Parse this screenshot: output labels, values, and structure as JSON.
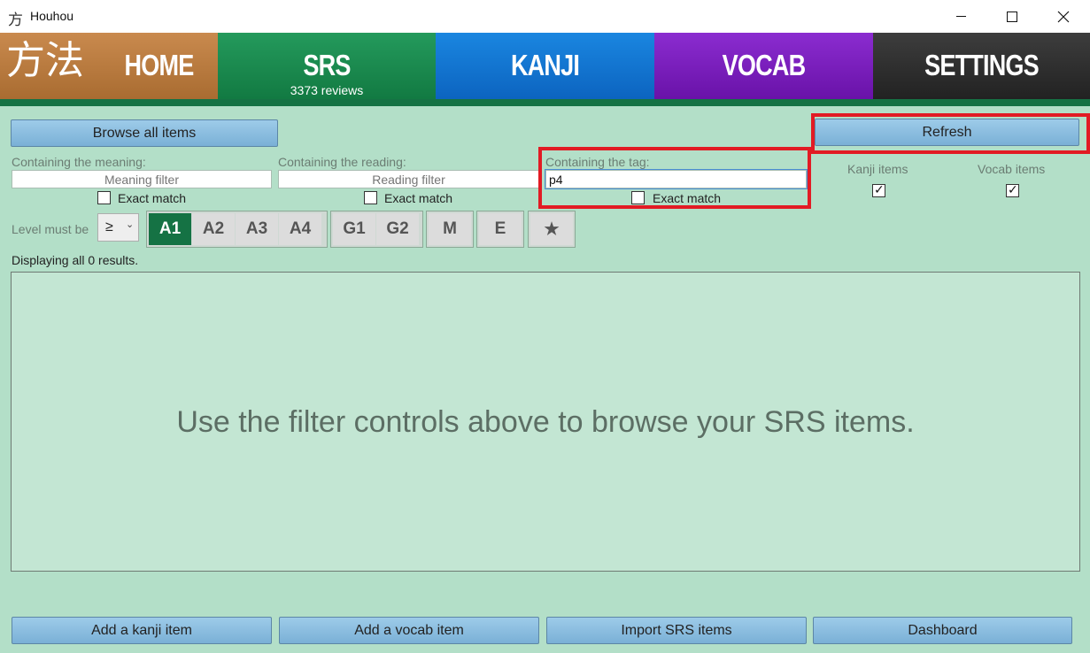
{
  "window": {
    "icon_glyph": "方",
    "title": "Houhou"
  },
  "nav": {
    "logo": "方法",
    "home": "HOME",
    "srs": "SRS",
    "srs_sub": "3373 reviews",
    "kanji": "KANJI",
    "vocab": "VOCAB",
    "settings": "SETTINGS"
  },
  "toolbar": {
    "browse_all": "Browse all items",
    "refresh": "Refresh"
  },
  "filters": {
    "meaning": {
      "label": "Containing the meaning:",
      "placeholder": "Meaning filter",
      "value": "",
      "exact_match": "Exact match",
      "exact_checked": false
    },
    "reading": {
      "label": "Containing the reading:",
      "placeholder": "Reading filter",
      "value": "",
      "exact_match": "Exact match",
      "exact_checked": false
    },
    "tag": {
      "label": "Containing the tag:",
      "placeholder": "",
      "value": "p4",
      "exact_match": "Exact match",
      "exact_checked": false
    },
    "kanji_items": {
      "label": "Kanji items",
      "checked": true
    },
    "vocab_items": {
      "label": "Vocab items",
      "checked": true
    }
  },
  "level": {
    "label": "Level must be",
    "operator": "≥",
    "groups": [
      [
        "A1",
        "A2",
        "A3",
        "A4"
      ],
      [
        "G1",
        "G2"
      ],
      [
        "M"
      ],
      [
        "E"
      ],
      [
        "★"
      ]
    ],
    "selected": "A1"
  },
  "results": {
    "count_text": "Displaying all 0 results.",
    "empty_message": "Use the filter controls above to browse your SRS items."
  },
  "footer": {
    "add_kanji": "Add a kanji item",
    "add_vocab": "Add a vocab item",
    "import": "Import SRS items",
    "dashboard": "Dashboard"
  },
  "colors": {
    "background": "#b3dfc8",
    "highlight": "#e21b24",
    "srs_tab": "#157244",
    "button": "#8bbde0"
  }
}
